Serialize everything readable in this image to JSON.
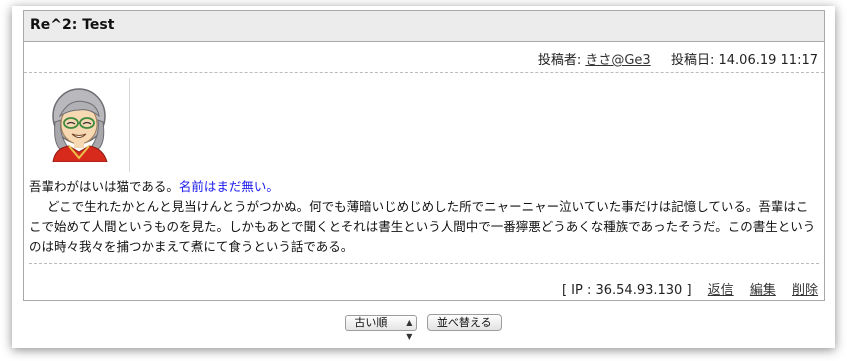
{
  "post": {
    "title": "Re^2: Test",
    "author_label": "投稿者:",
    "author_name": "きさ@Ge3",
    "date_label": "投稿日:",
    "date_value": "14.06.19 11:17",
    "body_line1_plain": "吾輩わがはいは猫である。",
    "body_line1_blue": "名前はまだ無い。",
    "body_paragraph": "どこで生れたかとんと見当けんとうがつかぬ。何でも薄暗いじめじめした所でニャーニャー泣いていた事だけは記憶している。吾輩はここで始めて人間というものを見た。しかもあとで聞くとそれは書生という人間中で一番獰悪どうあくな種族であったそうだ。この書生というのは時々我々を捕つかまえて煮にて食うという話である。",
    "ip_text": "[ IP : 36.54.93.130 ]",
    "reply_label": "返信",
    "edit_label": "編集",
    "delete_label": "削除"
  },
  "controls": {
    "sort_selected": "古い順",
    "sort_button": "並べ替える"
  },
  "colors": {
    "title_bg": "#ececec",
    "border": "#a9a9a9",
    "quote_blue": "#1a1aee"
  },
  "icons": {
    "avatar": "avatar-illustration",
    "select_arrow": "updown-arrow-icon"
  }
}
